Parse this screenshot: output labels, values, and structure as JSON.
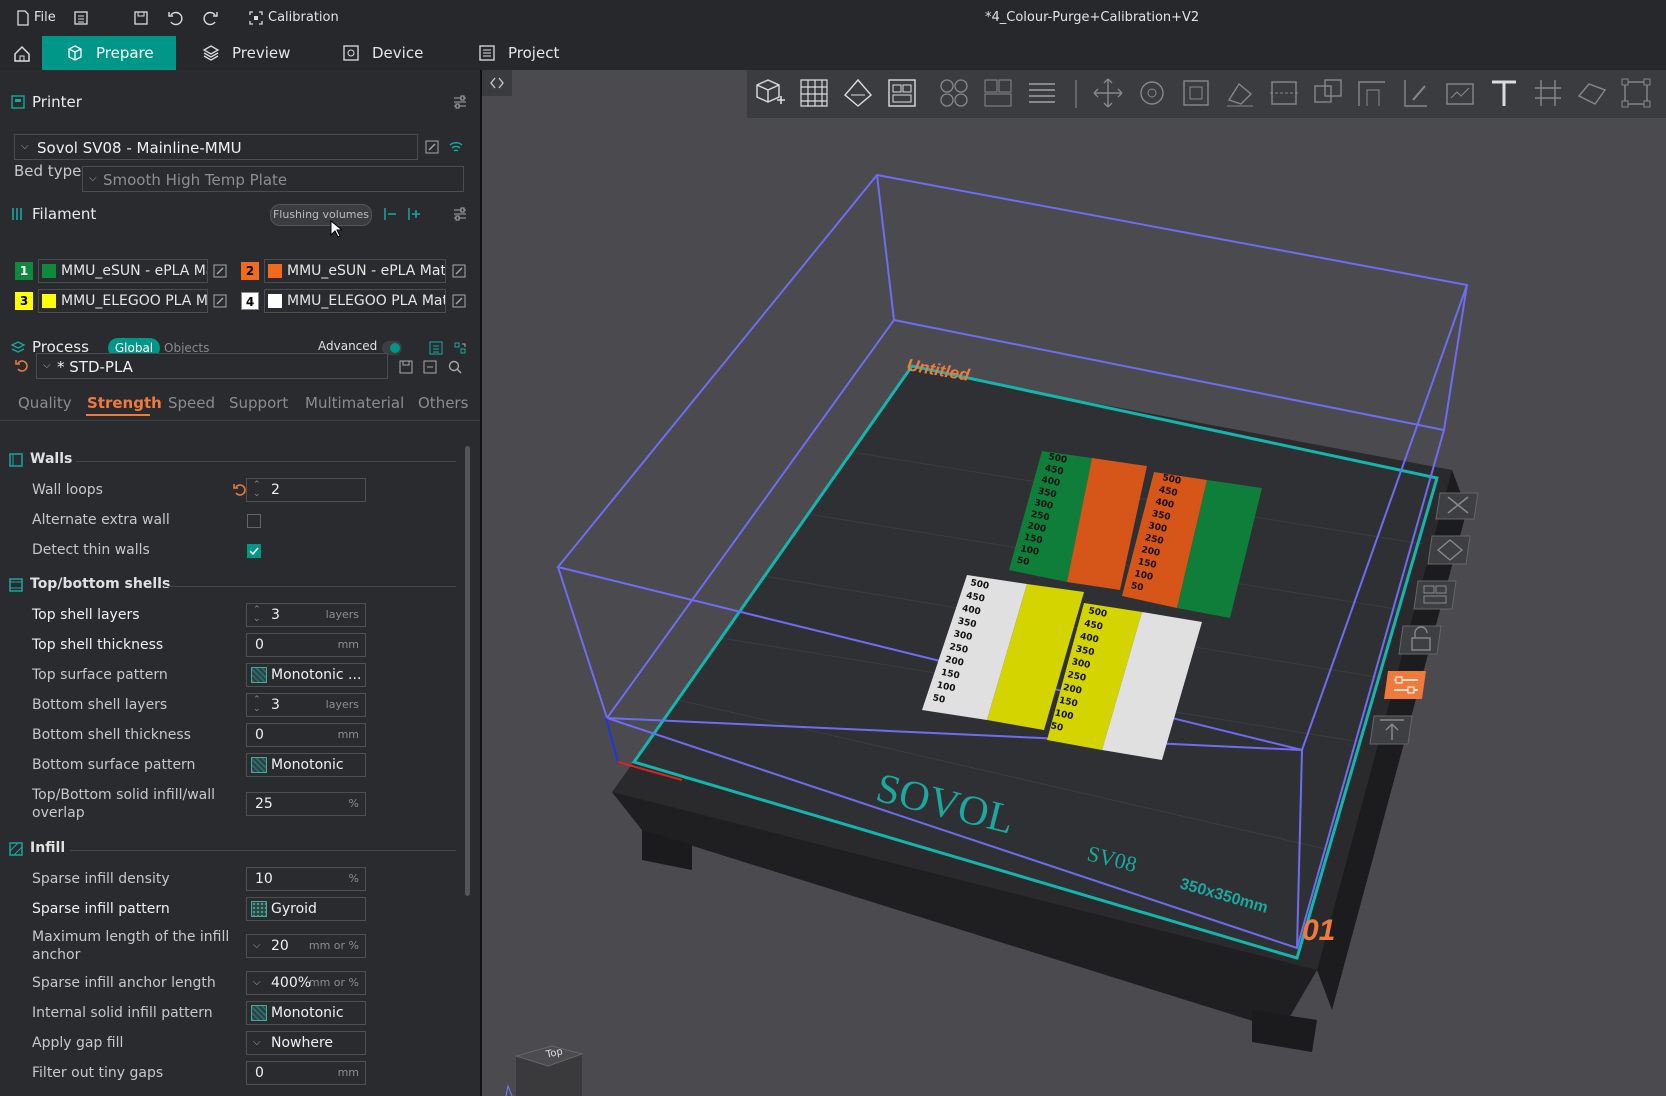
{
  "menu": {
    "file": "File",
    "calibration": "Calibration",
    "document_title": "*4_Colour-Purge+Calibration+V2"
  },
  "tabs": [
    {
      "label": "Prepare"
    },
    {
      "label": "Preview"
    },
    {
      "label": "Device"
    },
    {
      "label": "Project"
    }
  ],
  "printer": {
    "section_title": "Printer",
    "selected": "Sovol SV08 - Mainline-MMU",
    "bed_type_label": "Bed type",
    "bed_type": "Smooth High Temp Plate"
  },
  "filament": {
    "section_title": "Filament",
    "flushing_button": "Flushing volumes",
    "items": [
      {
        "num": "1",
        "name": "MMU_eSUN - ePLA Ma...",
        "color": "#0f8a3c"
      },
      {
        "num": "2",
        "name": "MMU_eSUN - ePLA Matt...",
        "color": "#f26a1b"
      },
      {
        "num": "3",
        "name": "MMU_ELEGOO PLA M...",
        "color": "#ffff00"
      },
      {
        "num": "4",
        "name": "MMU_ELEGOO PLA Matt...",
        "color": "#ffffff"
      }
    ]
  },
  "process": {
    "section_title": "Process",
    "global": "Global",
    "objects": "Objects",
    "advanced": "Advanced",
    "preset": "* STD-PLA",
    "tabs": [
      "Quality",
      "Strength",
      "Speed",
      "Support",
      "Multimaterial",
      "Others"
    ],
    "active_tab": "Strength"
  },
  "walls": {
    "title": "Walls",
    "wall_loops_label": "Wall loops",
    "wall_loops": "2",
    "alternate_label": "Alternate extra wall",
    "alternate_checked": false,
    "detect_label": "Detect thin walls",
    "detect_checked": true
  },
  "shells": {
    "title": "Top/bottom shells",
    "top_layers_label": "Top shell layers",
    "top_layers": "3",
    "layers_unit": "layers",
    "top_thick_label": "Top shell thickness",
    "top_thick": "0",
    "mm_unit": "mm",
    "top_pattern_label": "Top surface pattern",
    "top_pattern": "Monotonic ...",
    "bottom_layers_label": "Bottom shell layers",
    "bottom_layers": "3",
    "bottom_thick_label": "Bottom shell thickness",
    "bottom_thick": "0",
    "bottom_pattern_label": "Bottom surface pattern",
    "bottom_pattern": "Monotonic",
    "overlap_label_1": "Top/Bottom solid infill/wall",
    "overlap_label_2": "overlap",
    "overlap": "25",
    "pct_unit": "%"
  },
  "infill": {
    "title": "Infill",
    "density_label": "Sparse infill density",
    "density": "10",
    "pattern_label": "Sparse infill pattern",
    "pattern": "Gyroid",
    "anchor_max_label_1": "Maximum length of the infill",
    "anchor_max_label_2": "anchor",
    "anchor_max": "20",
    "mmpct_unit": "mm or %",
    "anchor_label": "Sparse infill anchor length",
    "anchor": "400%",
    "internal_label": "Internal solid infill pattern",
    "internal": "Monotonic",
    "gap_label": "Apply gap fill",
    "gap": "Nowhere",
    "tiny_label": "Filter out tiny gaps",
    "tiny": "0"
  },
  "scene": {
    "plate_name": "Untitled",
    "brand": "SOVOL",
    "model": "SV08",
    "size": "350x350mm",
    "plate_number": "01",
    "view_cube": "Top",
    "scale_marks": [
      "500",
      "450",
      "400",
      "350",
      "300",
      "250",
      "200",
      "150",
      "100",
      "50"
    ]
  },
  "colors": {
    "accent": "#009688",
    "orange": "#f07a3c",
    "bbox": "#6f6cf2",
    "bed_edge": "#14b5ad"
  }
}
